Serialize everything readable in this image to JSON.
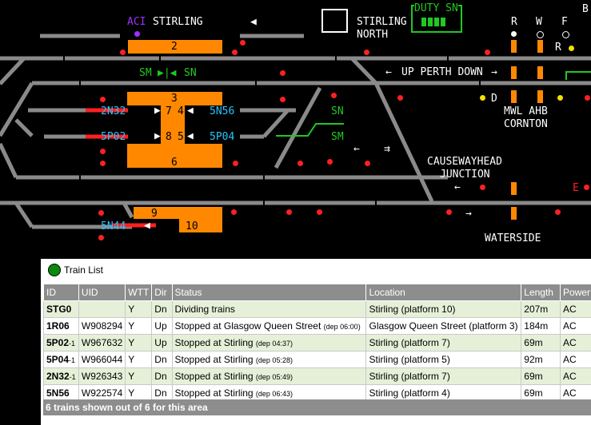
{
  "panel": {
    "labels": {
      "aci": "ACI",
      "stirling": "STIRLING",
      "stirling_north_1": "STIRLING",
      "stirling_north_2": "NORTH",
      "duty_sn": "DUTY SN",
      "r": "R",
      "w": "W",
      "f": "F",
      "b": "B",
      "r2": "R",
      "sm_left": "SM",
      "sn_left": "SN",
      "up_perth_down": "UP PERTH DOWN",
      "d": "D",
      "mwl_ahb": "MWL AHB",
      "cornton": "CORNTON",
      "sn_mid": "SN",
      "sm_mid": "SM",
      "causewayhead": "CAUSEWAYHEAD",
      "junction": "JUNCTION",
      "e": "E",
      "waterside": "WATERSIDE"
    },
    "platforms": {
      "p2": "2",
      "p3": "3",
      "p7": "7",
      "p4": "4",
      "p8": "8",
      "p5": "5",
      "p6": "6",
      "p9": "9",
      "p10": "10"
    },
    "headcodes": {
      "h2n32": "2N32",
      "h5n56": "5N56",
      "h5p02": "5P02",
      "h5p04": "5P04",
      "h5n44": "5N44"
    },
    "colors": {
      "track": "#8a8a8a",
      "platform": "#ff8800",
      "signal_red": "#ff2020",
      "headcode": "#29c4ff",
      "label_white": "#ffffff",
      "label_green": "#21c821",
      "aci_purple": "#9b30ff"
    }
  },
  "train_list": {
    "title": "Train List",
    "columns": [
      "ID",
      "UID",
      "WTT",
      "Dir",
      "Status",
      "Location",
      "Length",
      "Power"
    ],
    "rows": [
      {
        "id": "STG0",
        "id_sub": "",
        "uid": "",
        "wtt": "Y",
        "dir": "Dn",
        "status": "Dividing trains",
        "dep": "",
        "location": "Stirling (platform 10)",
        "length": "207m",
        "power": "AC"
      },
      {
        "id": "1R06",
        "id_sub": "",
        "uid": "W908294",
        "wtt": "Y",
        "dir": "Up",
        "status": "Stopped at Glasgow Queen Street",
        "dep": "(dep 06:00)",
        "location": "Glasgow Queen Street (platform 3)",
        "length": "184m",
        "power": "AC"
      },
      {
        "id": "5P02",
        "id_sub": "-1",
        "uid": "W967632",
        "wtt": "Y",
        "dir": "Up",
        "status": "Stopped at Stirling",
        "dep": "(dep 04:37)",
        "location": "Stirling (platform 7)",
        "length": "69m",
        "power": "AC"
      },
      {
        "id": "5P04",
        "id_sub": "-1",
        "uid": "W966044",
        "wtt": "Y",
        "dir": "Dn",
        "status": "Stopped at Stirling",
        "dep": "(dep 05:28)",
        "location": "Stirling (platform 5)",
        "length": "92m",
        "power": "AC"
      },
      {
        "id": "2N32",
        "id_sub": "-1",
        "uid": "W926343",
        "wtt": "Y",
        "dir": "Dn",
        "status": "Stopped at Stirling",
        "dep": "(dep 05:49)",
        "location": "Stirling (platform 7)",
        "length": "69m",
        "power": "AC"
      },
      {
        "id": "5N56",
        "id_sub": "",
        "uid": "W922574",
        "wtt": "Y",
        "dir": "Dn",
        "status": "Stopped at Stirling",
        "dep": "(dep 06:43)",
        "location": "Stirling (platform 4)",
        "length": "69m",
        "power": "AC"
      }
    ],
    "footer": "6 trains shown out of 6 for this area"
  }
}
